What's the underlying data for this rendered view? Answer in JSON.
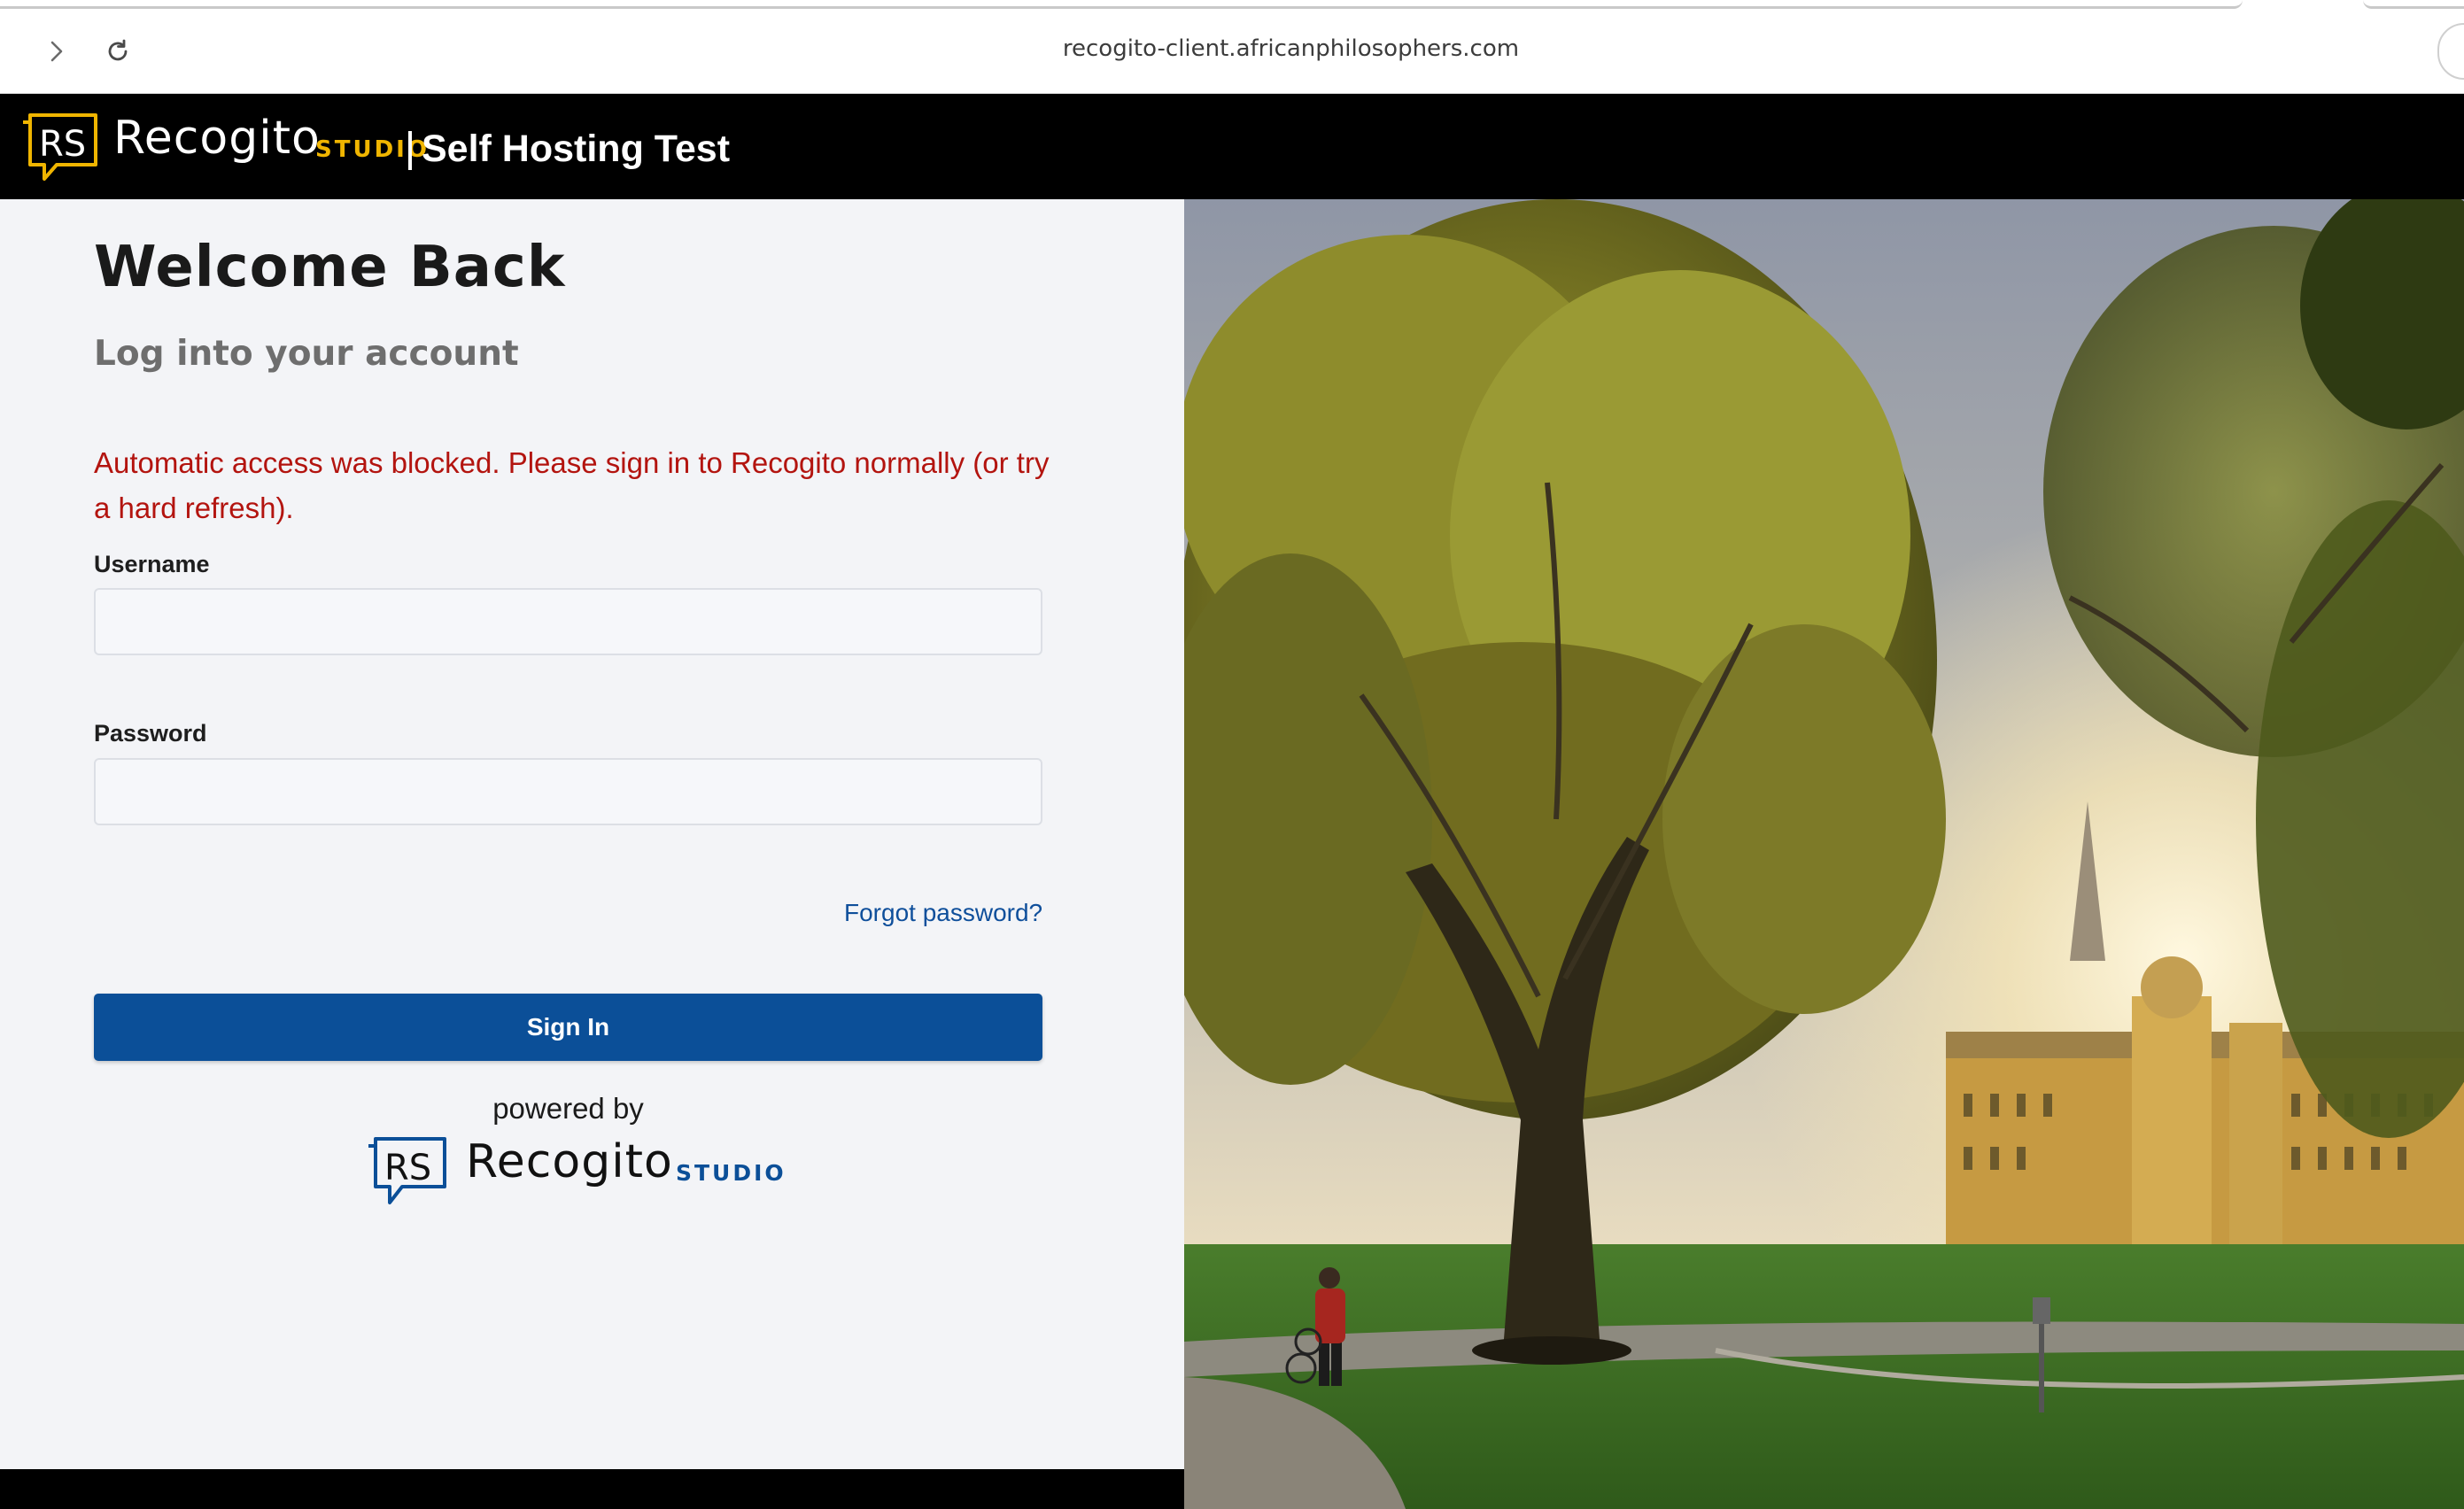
{
  "browser": {
    "url": "recogito-client.africanphilosophers.com"
  },
  "header": {
    "logo_letters": "RS",
    "brand": "Recogito",
    "studio": "STUDIO",
    "site_title": "Self Hosting Test"
  },
  "login": {
    "title": "Welcome Back",
    "subtitle": "Log into your account",
    "error_message": "Automatic access was blocked. Please sign in to Recogito normally (or try a hard refresh).",
    "username_label": "Username",
    "username_value": "",
    "password_label": "Password",
    "password_value": "",
    "forgot_password": "Forgot password?",
    "sign_in": "Sign In",
    "powered_by": "powered by",
    "footer_brand": "Recogito",
    "footer_studio": "STUDIO"
  },
  "colors": {
    "header_bg": "#000000",
    "studio_accent": "#f0b500",
    "primary_button": "#0b4f98",
    "error_text": "#b3140f",
    "panel_bg": "#f3f4f7"
  }
}
